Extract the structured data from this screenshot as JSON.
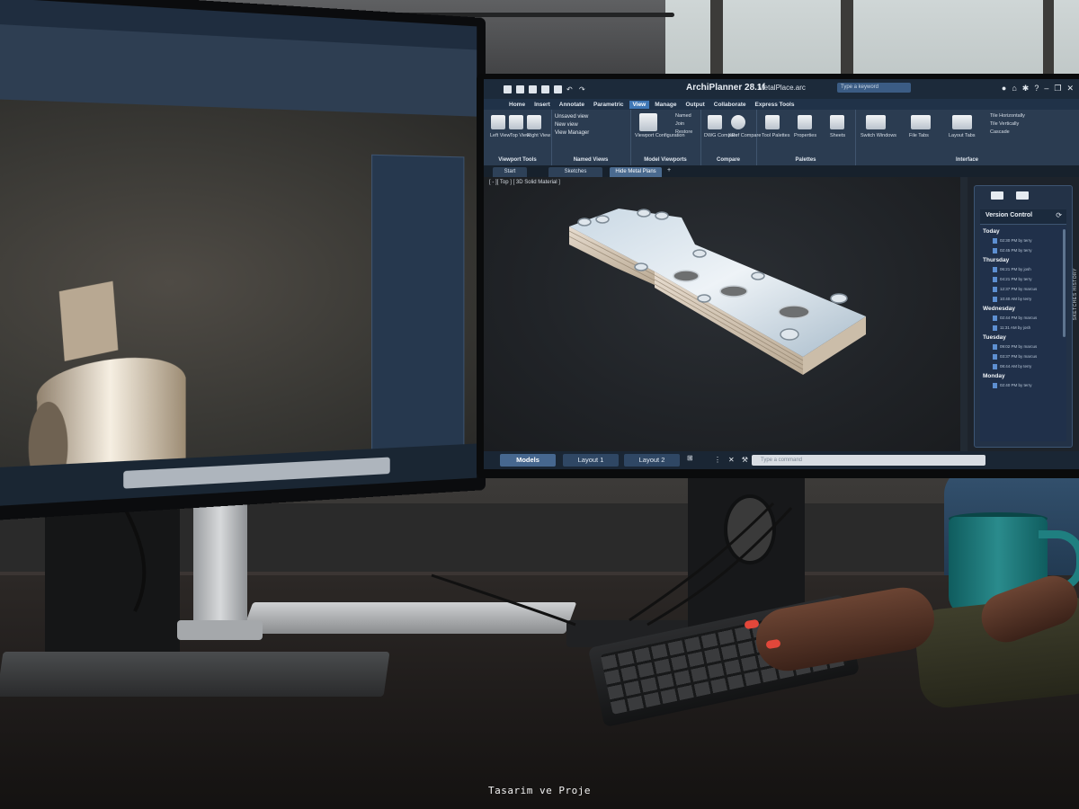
{
  "app": {
    "title": "ArchiPlanner 28.1f",
    "file_name": "MetalPlace.arc",
    "search_placeholder": "Type a keyword"
  },
  "ribbon_tabs": [
    "Home",
    "Insert",
    "Annotate",
    "Parametric",
    "View",
    "Manage",
    "Output",
    "Collaborate",
    "Express Tools"
  ],
  "active_ribbon_tab": "View",
  "ribbon": {
    "viewport_tools": {
      "buttons": [
        "Left View",
        "Top View",
        "Right View"
      ],
      "label": "Viewport Tools"
    },
    "named_views": {
      "items": [
        "Unsaved view",
        "New view",
        "View Manager"
      ],
      "label": "Named Views"
    },
    "model_viewports": {
      "buttons": [
        "Viewport Configuration"
      ],
      "items": [
        "Named",
        "Join",
        "Restore"
      ],
      "label": "Model Viewports"
    },
    "compare": {
      "buttons": [
        "DWG Compare",
        "XRef Compare"
      ],
      "label": "Compare"
    },
    "palettes": {
      "buttons": [
        "Tool Palettes",
        "Properties",
        "Sheets"
      ],
      "label": "Palettes"
    },
    "interface": {
      "buttons": [
        "Switch Windows",
        "File Tabs",
        "Layout Tabs"
      ],
      "items": [
        "Tile Horizontally",
        "Tile Vertically",
        "Cascade"
      ],
      "label": "Interface"
    }
  },
  "doc_tabs": [
    "Start",
    "Sketches",
    "Hide Metal Plans"
  ],
  "active_doc_tab": "Hide Metal Plans",
  "viewport_label": "[ - ][ Top ] [ 3D Solid Material ]",
  "version_control": {
    "title": "Version Control",
    "groups": [
      {
        "day": "Today",
        "entries": [
          "02:30 PM by terry",
          "02:45 PM by terry"
        ]
      },
      {
        "day": "Thursday",
        "entries": [
          "06:21 PM by josh",
          "04:21 PM by terry",
          "12:37 PM by marcus",
          "10:40 AM by terry"
        ]
      },
      {
        "day": "Wednesday",
        "entries": [
          "02:44 PM by marcus",
          "11:31 AM by josh"
        ]
      },
      {
        "day": "Tuesday",
        "entries": [
          "09:02 PM by marcus",
          "03:37 PM by marcus",
          "08:44 AM by terry"
        ]
      },
      {
        "day": "Monday",
        "entries": [
          "02:40 PM by terry"
        ]
      }
    ],
    "side_label": "SKETCHES HISTORY"
  },
  "layout_tabs": [
    "Models",
    "Layout 1",
    "Layout 2"
  ],
  "active_layout_tab": "Models",
  "command_placeholder": "Type a command",
  "watermark": "Tasarim ve Proje",
  "colors": {
    "ui_dark": "#1d232b",
    "ui_panel": "#233247",
    "accent": "#3f77b5",
    "mug": "#1f7f80"
  }
}
